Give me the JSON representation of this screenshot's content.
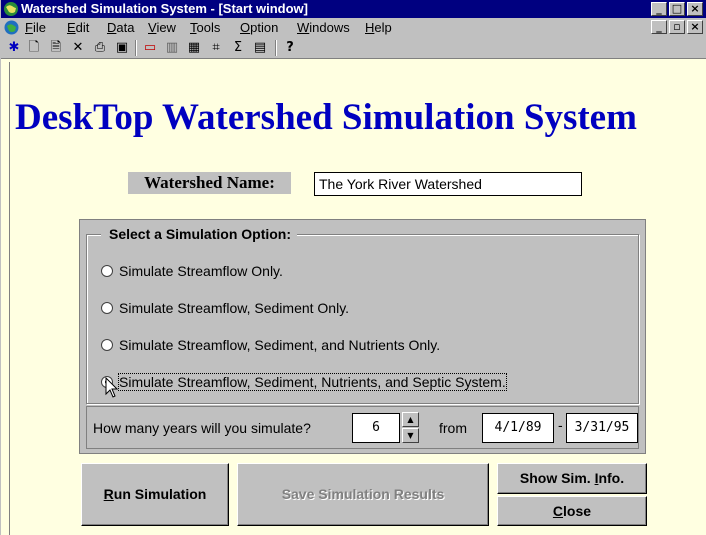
{
  "window": {
    "title": "Watershed Simulation System - [Start window]",
    "title_buttons": [
      "_",
      "□",
      "×"
    ],
    "doc_buttons": [
      "_",
      "▫",
      "×"
    ]
  },
  "menubar": {
    "items": [
      {
        "pre": "",
        "key": "F",
        "post": "ile"
      },
      {
        "pre": "",
        "key": "E",
        "post": "dit"
      },
      {
        "pre": "",
        "key": "D",
        "post": "ata"
      },
      {
        "pre": "",
        "key": "V",
        "post": "iew"
      },
      {
        "pre": "",
        "key": "T",
        "post": "ools"
      },
      {
        "pre": "",
        "key": "O",
        "post": "ption"
      },
      {
        "pre": "",
        "key": "W",
        "post": "indows"
      },
      {
        "pre": "",
        "key": "H",
        "post": "elp"
      }
    ]
  },
  "toolbar": {
    "icons": [
      "run-icon",
      "new-document-icon",
      "open-document-icon",
      "delete-icon",
      "print-icon",
      "window-icon",
      "map-icon",
      "chart-icon",
      "grid-icon",
      "network-icon",
      "sum-icon",
      "table-icon",
      "help-icon"
    ],
    "glyphs": [
      "✱",
      "🗋",
      "🗎",
      "✕",
      "⎙",
      "▣",
      "▭",
      "▥",
      "▦",
      "⌗",
      "Σ",
      "▤",
      "?"
    ]
  },
  "header": {
    "title": "DeskTop Watershed Simulation System"
  },
  "watershed": {
    "label": "Watershed Name:",
    "value": "The York River Watershed"
  },
  "simulation": {
    "group_title": "Select a Simulation Option:",
    "options": [
      {
        "label": "Simulate Streamflow Only.",
        "checked": false
      },
      {
        "label": "Simulate Streamflow, Sediment Only.",
        "checked": false
      },
      {
        "label": "Simulate Streamflow, Sediment, and Nutrients Only.",
        "checked": false
      },
      {
        "label": "Simulate Streamflow, Sediment, Nutrients, and Septic System.",
        "checked": true
      }
    ]
  },
  "years": {
    "question": "How many years will you simulate?",
    "value": "6",
    "from_label": "from",
    "start_date": "4/1/89",
    "dash": "-",
    "end_date": "3/31/95"
  },
  "buttons": {
    "run": {
      "key": "R",
      "rest": "un Simulation"
    },
    "save": {
      "label": "Save Simulation Results"
    },
    "show": {
      "pre": "Show Sim. ",
      "key": "I",
      "post": "nfo."
    },
    "close": {
      "key": "C",
      "rest": "lose"
    }
  },
  "colors": {
    "title_bar": "#000080",
    "background": "#ffffe1",
    "heading": "#0000c0",
    "panel": "#c0c0c0"
  }
}
